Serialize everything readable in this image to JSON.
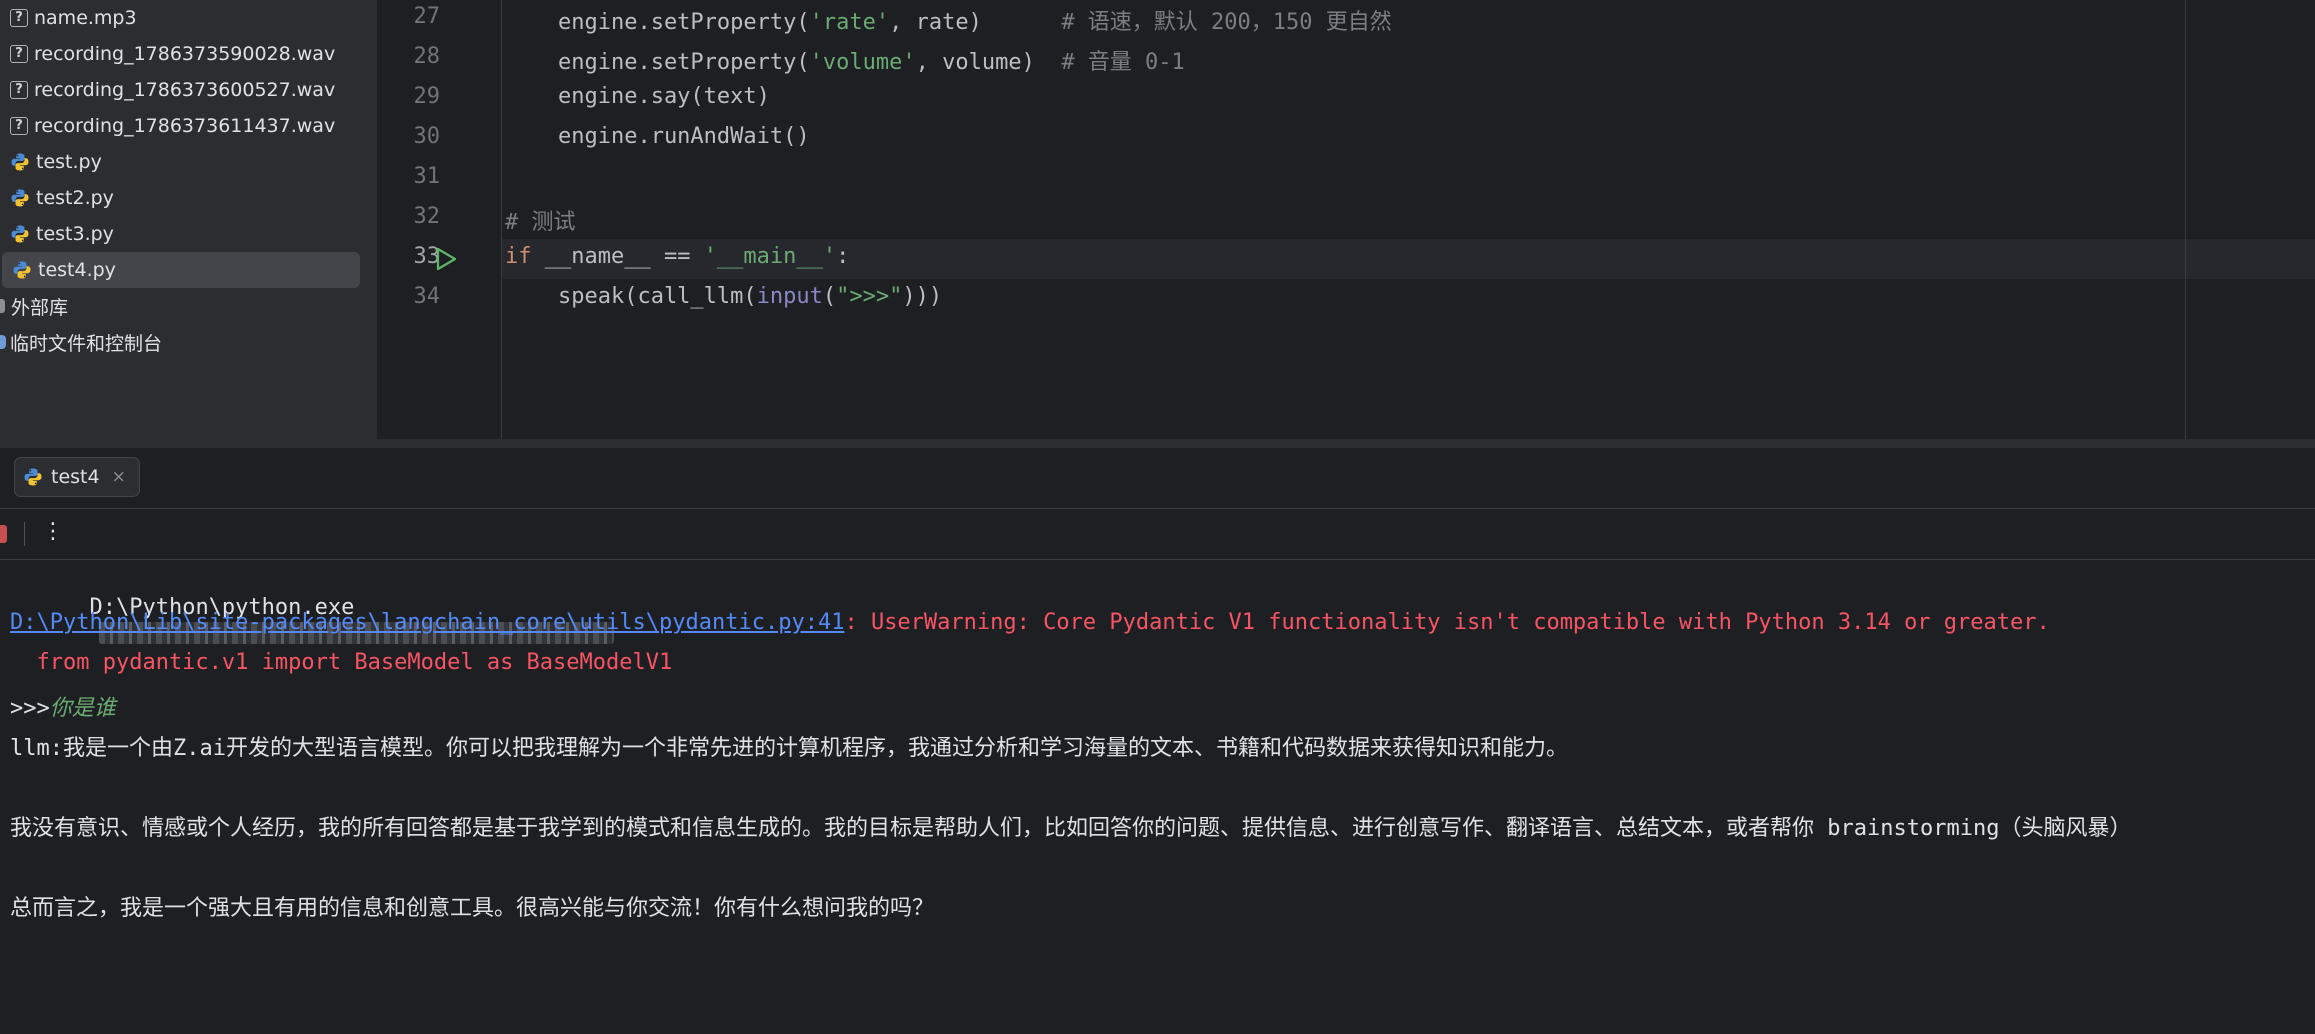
{
  "project": {
    "files": [
      {
        "name": "name.mp3",
        "icon": "unknown-file-icon"
      },
      {
        "name": "recording_1786373590028.wav",
        "icon": "unknown-file-icon"
      },
      {
        "name": "recording_1786373600527.wav",
        "icon": "unknown-file-icon"
      },
      {
        "name": "recording_1786373611437.wav",
        "icon": "unknown-file-icon"
      },
      {
        "name": "test.py",
        "icon": "python-file-icon"
      },
      {
        "name": "test2.py",
        "icon": "python-file-icon"
      },
      {
        "name": "test3.py",
        "icon": "python-file-icon"
      },
      {
        "name": "test4.py",
        "icon": "python-file-icon",
        "selected": true
      }
    ],
    "external_libraries": "外部库",
    "scratches": "临时文件和控制台"
  },
  "editor": {
    "line_numbers": [
      "27",
      "28",
      "29",
      "30",
      "31",
      "32",
      "33",
      "34"
    ],
    "lines": {
      "l27": {
        "code": "    engine.setProperty(",
        "str": "'rate'",
        "rest": ", rate)      ",
        "comment": "# 语速，默认 200，150 更自然"
      },
      "l28": {
        "code": "    engine.setProperty(",
        "str": "'volume'",
        "rest": ", volume)  ",
        "comment": "# 音量 0-1"
      },
      "l29": {
        "code": "    engine.say(text)"
      },
      "l30": {
        "code": "    engine.runAndWait()"
      },
      "l32": {
        "comment": "# 测试"
      },
      "l33": {
        "kw": "if",
        "mid": " __name__ == ",
        "str": "'__main__'",
        "end": ":"
      },
      "l34": {
        "pre": "    speak(call_llm(",
        "builtin": "input",
        "open": "(",
        "str": "\">>>\"",
        "end": ")))"
      }
    }
  },
  "run": {
    "tab_label": "test4",
    "tab_close": "×",
    "more_icon": "⋮",
    "console": {
      "interpreter": "D:\\Python\\python.exe",
      "warning_link": "D:\\Python\\Lib\\site-packages\\langchain_core\\utils\\pydantic.py:41",
      "warning_text": ": UserWarning: Core Pydantic V1 functionality isn't compatible with Python 3.14 or greater.",
      "warning_line2": "  from pydantic.v1 import BaseModel as BaseModelV1",
      "prompt": ">>>",
      "user_input": "你是谁",
      "reply_line1": "llm:我是一个由Z.ai开发的大型语言模型。你可以把我理解为一个非常先进的计算机程序，我通过分析和学习海量的文本、书籍和代码数据来获得知识和能力。",
      "reply_line2": "我没有意识、情感或个人经历，我的所有回答都是基于我学到的模式和信息生成的。我的目标是帮助人们，比如回答你的问题、提供信息、进行创意写作、翻译语言、总结文本，或者帮你 brainstorming（头脑风暴）",
      "reply_line3": "总而言之，我是一个强大且有用的信息和创意工具。很高兴能与你交流！你有什么想问我的吗？"
    }
  },
  "colors": {
    "background": "#1e1f22",
    "panel": "#2b2d30",
    "keyword": "#cf8e6d",
    "string": "#6aab73",
    "comment": "#7a7e85",
    "error": "#f75464",
    "link": "#548af7"
  }
}
